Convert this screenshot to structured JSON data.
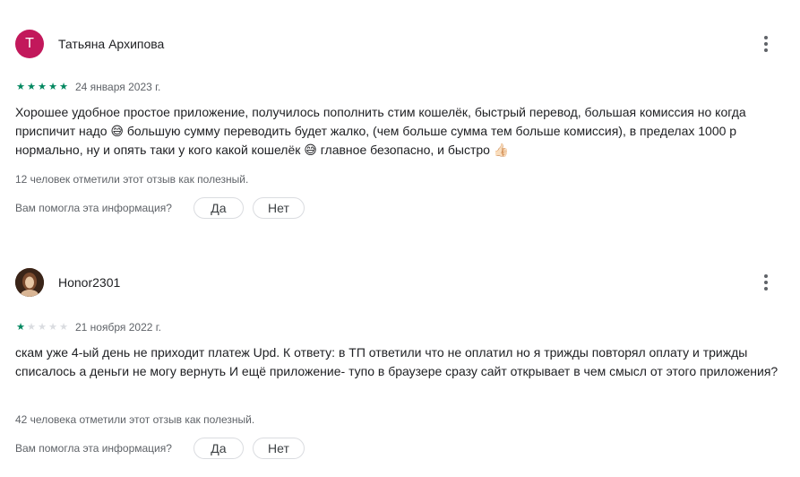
{
  "reviews": [
    {
      "avatar_letter": "Т",
      "avatar_color": "#c2185b",
      "author": "Татьяна Архипова",
      "rating": 5,
      "date": "24 января 2023 г.",
      "text": "Хорошее удобное простое приложение, получилось пополнить стим кошелёк, быстрый перевод, большая комиссия но когда приспичит надо 😅 большую сумму переводить будет жалко, (чем больше сумма тем больше комиссия), в пределах 1000 р нормально, ну и опять таки у кого какой кошелёк 😅 главное безопасно, и быстро 👍🏻",
      "helpful_count": "12 человек отметили этот отзыв как полезный.",
      "helpful_question": "Вам помогла эта информация?",
      "yes_label": "Да",
      "no_label": "Нет"
    },
    {
      "avatar_icon": "user-photo",
      "author": "Honor2301",
      "rating": 1,
      "date": "21 ноября 2022 г.",
      "text": "скам уже 4-ый день не приходит платеж Upd. К ответу: в ТП ответили что не оплатил но я трижды повторял оплату и трижды списалось а деньги не могу вернуть И ещё приложение- тупо в браузере сразу сайт открывает в чем смысл от этого приложения?",
      "helpful_count": "42 человека отметили этот отзыв как полезный.",
      "helpful_question": "Вам помогла эта информация?",
      "yes_label": "Да",
      "no_label": "Нет"
    }
  ],
  "colors": {
    "star_on": "#01875f",
    "star_off": "#dadce0",
    "secondary_text": "#5f6368"
  }
}
